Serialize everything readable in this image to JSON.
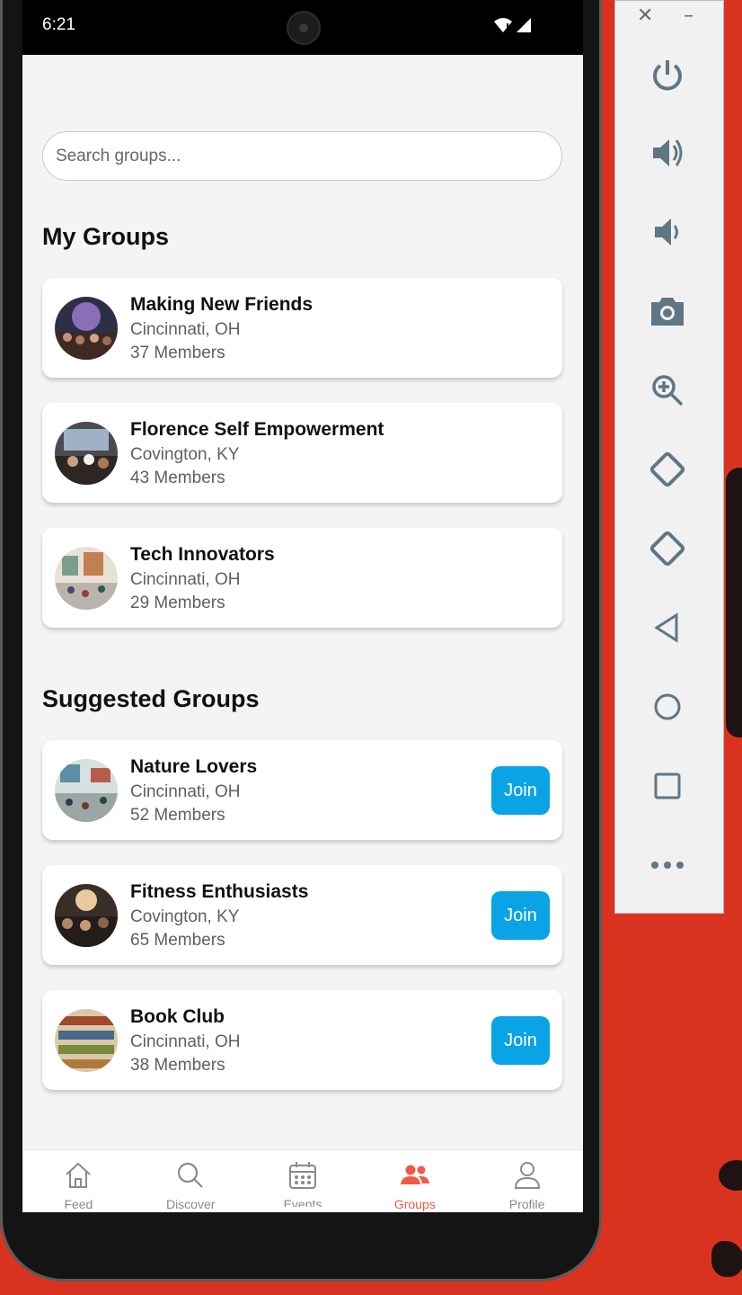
{
  "status_bar": {
    "time": "6:21"
  },
  "search": {
    "placeholder": "Search groups..."
  },
  "sections": {
    "my_groups_title": "My Groups",
    "suggested_title": "Suggested Groups"
  },
  "my_groups": [
    {
      "name": "Making New Friends",
      "location": "Cincinnati, OH",
      "members": "37 Members"
    },
    {
      "name": "Florence Self Empowerment",
      "location": "Covington, KY",
      "members": "43 Members"
    },
    {
      "name": "Tech Innovators",
      "location": "Cincinnati, OH",
      "members": "29 Members"
    }
  ],
  "suggested_groups": [
    {
      "name": "Nature Lovers",
      "location": "Cincinnati, OH",
      "members": "52 Members",
      "action": "Join"
    },
    {
      "name": "Fitness Enthusiasts",
      "location": "Covington, KY",
      "members": "65 Members",
      "action": "Join"
    },
    {
      "name": "Book Club",
      "location": "Cincinnati, OH",
      "members": "38 Members",
      "action": "Join"
    }
  ],
  "bottom_nav": [
    {
      "label": "Feed",
      "icon": "home-icon"
    },
    {
      "label": "Discover",
      "icon": "search-icon"
    },
    {
      "label": "Events",
      "icon": "calendar-icon"
    },
    {
      "label": "Groups",
      "icon": "groups-icon",
      "active": true
    },
    {
      "label": "Profile",
      "icon": "person-icon"
    }
  ],
  "emulator_controls": [
    "power-icon",
    "volume-up-icon",
    "volume-down-icon",
    "camera-icon",
    "zoom-icon",
    "rotate-left-icon",
    "rotate-right-icon",
    "back-icon",
    "home-circle-icon",
    "overview-icon",
    "more-icon"
  ],
  "colors": {
    "accent": "#f05a47",
    "join_button": "#0aa3e6",
    "screen_background": "#f4f4f4",
    "desktop_background": "#d9331f"
  }
}
